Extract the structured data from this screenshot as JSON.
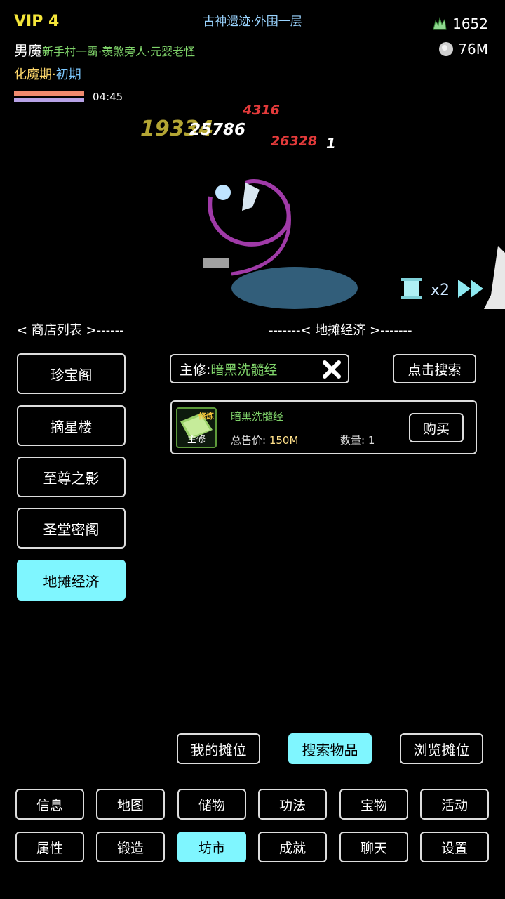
{
  "hud": {
    "vip": "VIP 4",
    "location": "古神遗迹·外围一层",
    "currency1": "1652",
    "currency2": "76M",
    "gender": "男魔",
    "titles": "新手村一霸·羡煞旁人·元婴老怪",
    "realm": "化魔期",
    "realm_sep": "·",
    "realm_stage": "初期",
    "timer": "04:45"
  },
  "battle": {
    "damage": [
      "4316",
      "19334",
      "25786",
      "26328",
      "1"
    ],
    "speed": "x2"
  },
  "shop": {
    "list_header": "< 商店列表 >------",
    "panel_header": "-------< 地摊经济 >-------",
    "items": [
      {
        "label": "珍宝阁"
      },
      {
        "label": "摘星楼"
      },
      {
        "label": "至尊之影"
      },
      {
        "label": "圣堂密阁"
      },
      {
        "label": "地摊经济"
      }
    ]
  },
  "search": {
    "prefix": "主修:",
    "value": "暗黑洗髓经",
    "button": "点击搜索"
  },
  "listing": {
    "tag": "修炼",
    "type": "主修",
    "name": "暗黑洗髓经",
    "price_label": "总售价: ",
    "price": "150M",
    "qty_label": "数量: ",
    "qty": "1",
    "buy": "购买"
  },
  "sub_tabs": [
    {
      "label": "我的摊位"
    },
    {
      "label": "搜索物品"
    },
    {
      "label": "浏览摊位"
    }
  ],
  "nav_row1": [
    {
      "label": "信息"
    },
    {
      "label": "地图"
    },
    {
      "label": "储物"
    },
    {
      "label": "功法"
    },
    {
      "label": "宝物"
    },
    {
      "label": "活动"
    }
  ],
  "nav_row2": [
    {
      "label": "属性"
    },
    {
      "label": "锻造"
    },
    {
      "label": "坊市"
    },
    {
      "label": "成就"
    },
    {
      "label": "聊天"
    },
    {
      "label": "设置"
    }
  ],
  "colors": {
    "accent": "#7ff6ff",
    "green_text": "#7fd36a",
    "vip": "#f5e63a"
  }
}
